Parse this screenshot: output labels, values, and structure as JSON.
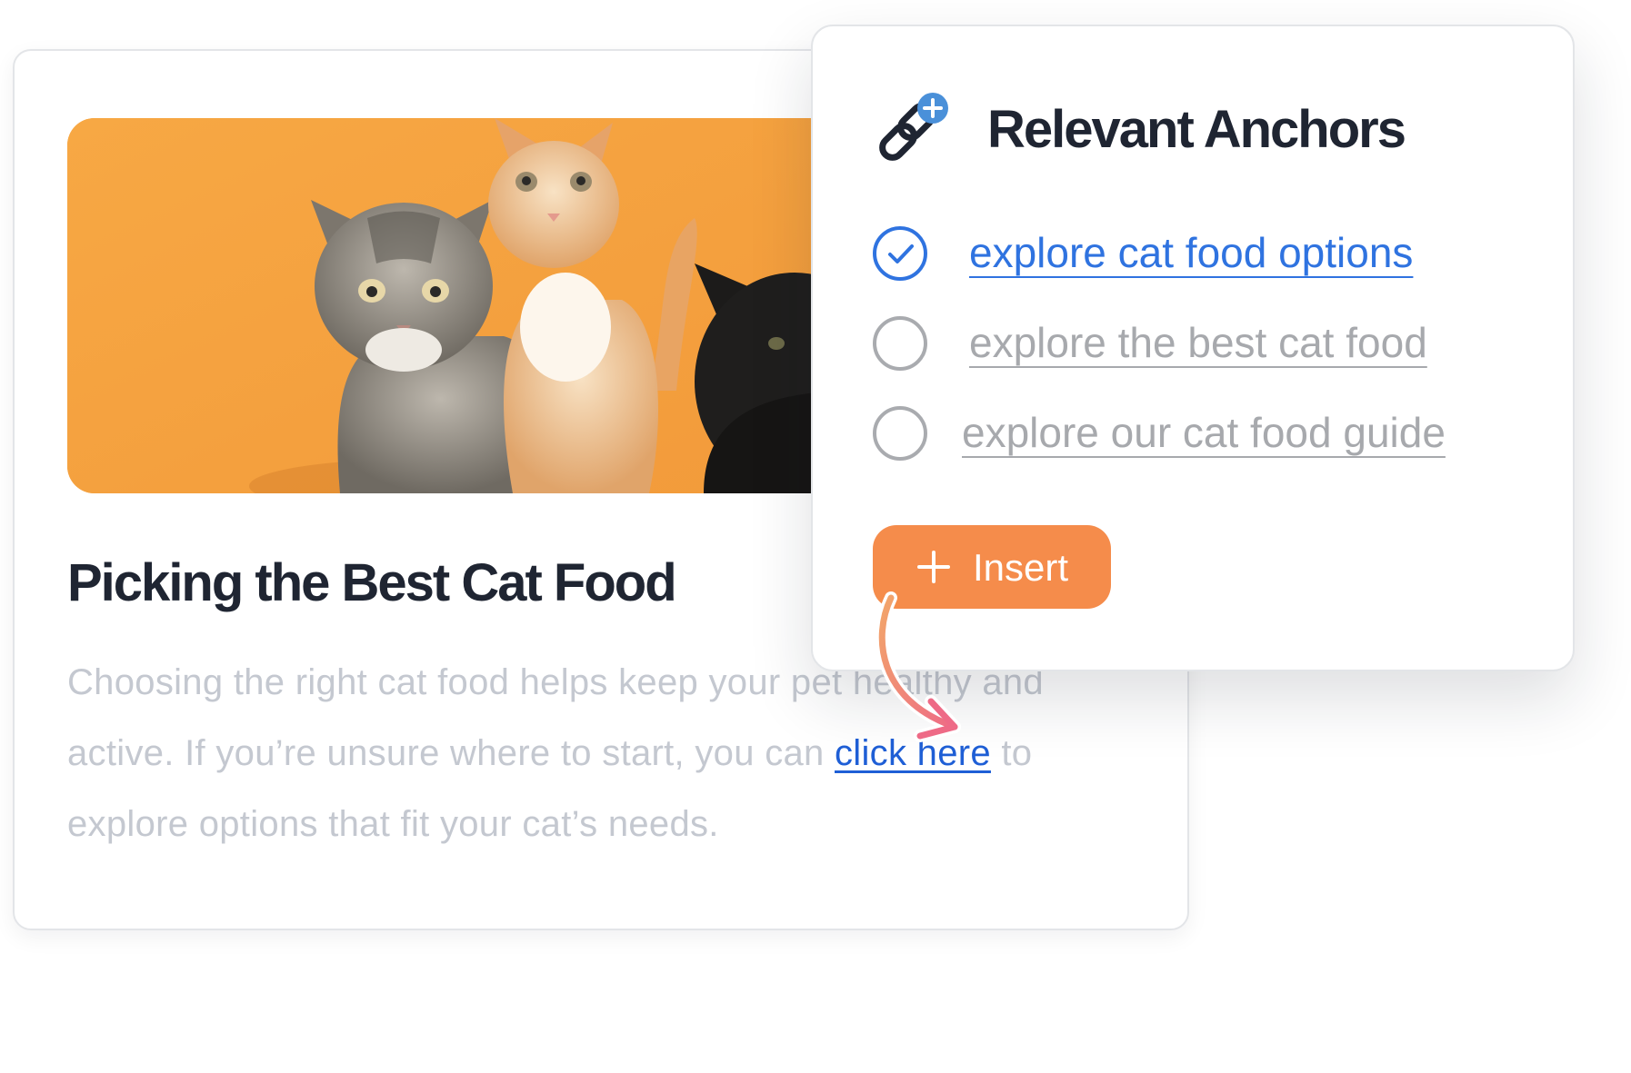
{
  "article": {
    "image": {
      "description": "kittens-on-orange"
    },
    "title": "Picking the Best Cat Food",
    "body_part1": "Choosing the right cat food helps keep your pet healthy and active. If you’re unsure where to start, you can ",
    "link_text": "click here",
    "body_part2": " to explore options that fit your cat’s needs."
  },
  "popover": {
    "title": "Relevant Anchors",
    "icon": "link-plus-icon",
    "options": [
      {
        "label": "explore cat food options",
        "selected": true
      },
      {
        "label": "explore the best cat food",
        "selected": false
      },
      {
        "label": "explore our cat food guide",
        "selected": false
      }
    ],
    "insert_label": "Insert"
  },
  "colors": {
    "accent_blue": "#2f73e0",
    "link_blue": "#1f5fd6",
    "button_orange": "#f58c4b",
    "arrow_start": "#f2a66a",
    "arrow_end": "#ee6a86",
    "title_dark": "#1f2532",
    "muted_text": "#c4c8d0",
    "hero_background": "#f6a341"
  }
}
